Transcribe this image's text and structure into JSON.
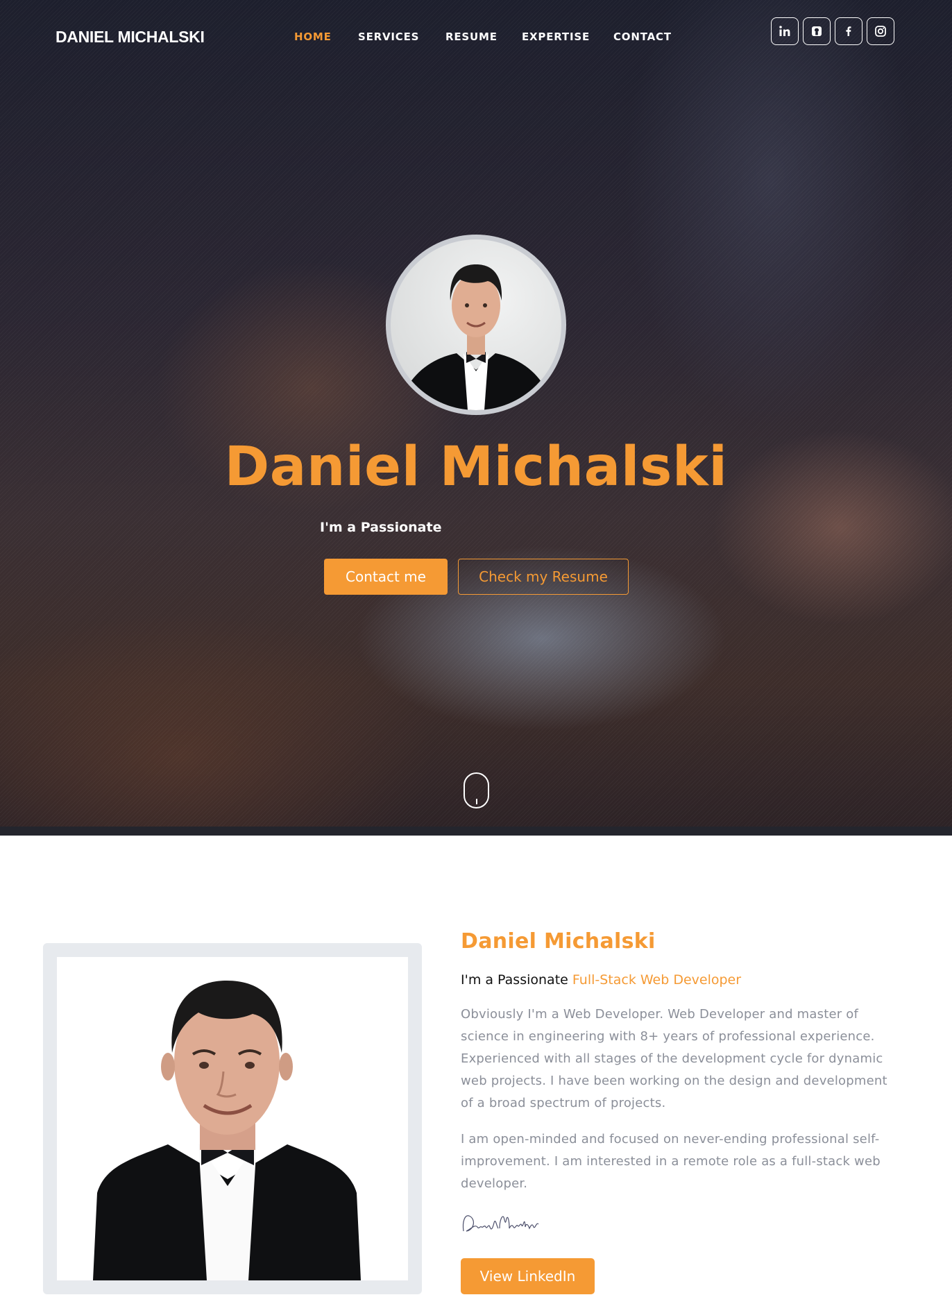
{
  "header": {
    "brand": "DANIEL MICHALSKI",
    "nav": [
      {
        "label": "HOME",
        "active": true
      },
      {
        "label": "SERVICES",
        "active": false
      },
      {
        "label": "RESUME",
        "active": false
      },
      {
        "label": "EXPERTISE",
        "active": false
      },
      {
        "label": "CONTACT",
        "active": false
      }
    ],
    "social": [
      "linkedin-icon",
      "github-icon",
      "facebook-icon",
      "instagram-icon"
    ]
  },
  "hero": {
    "name": "Daniel Michalski",
    "subtitle": "I'm a Passionate",
    "contact_button": "Contact me",
    "resume_button": "Check my Resume"
  },
  "about": {
    "name": "Daniel Michalski",
    "tagline_prefix": "I'm a Passionate",
    "tagline_role": "Full-Stack Web Developer",
    "paragraph1": "Obviously I'm a Web Developer. Web Developer and master of science in engineering with 8+ years of professional experience. Experienced with all stages of the development cycle for dynamic web projects. I have been working on the design and development of a broad spectrum of projects.",
    "paragraph2": "I am open-minded and focused on never-ending professional self-improvement. I am interested in a remote role as a full-stack web developer.",
    "signature": "Daniel Michalski",
    "linkedin_button": "View LinkedIn"
  },
  "colors": {
    "accent": "#f59a34",
    "text_muted": "#8b8f99",
    "frame": "#e7eaee"
  }
}
